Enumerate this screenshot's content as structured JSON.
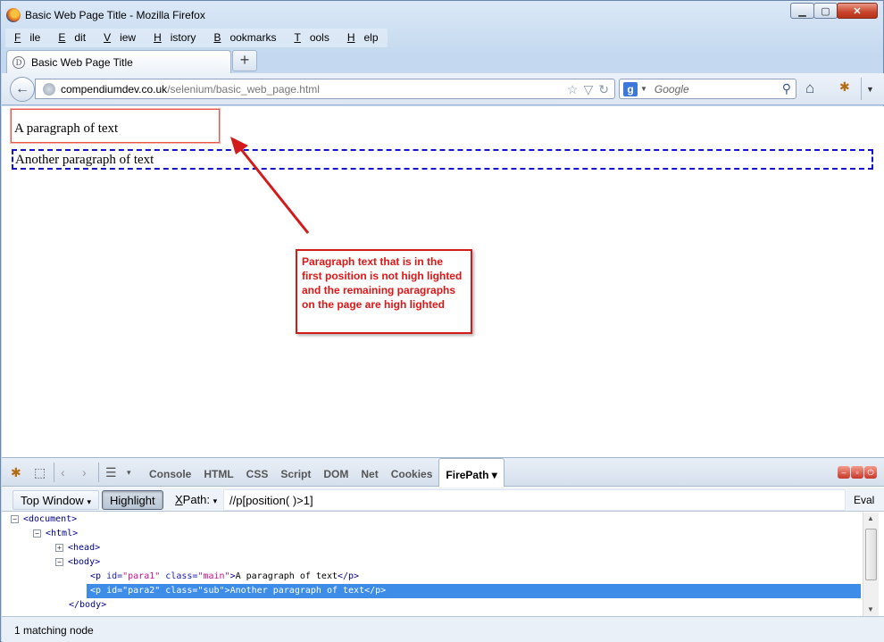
{
  "window": {
    "title": "Basic Web Page Title - Mozilla Firefox",
    "minimize_glyph": "▁",
    "maximize_glyph": "▢",
    "close_glyph": "✕"
  },
  "menubar": {
    "items": [
      {
        "key": "F",
        "rest": "ile"
      },
      {
        "key": "E",
        "rest": "dit"
      },
      {
        "key": "V",
        "rest": "iew"
      },
      {
        "key": "H",
        "rest": "istory"
      },
      {
        "key": "B",
        "rest": "ookmarks"
      },
      {
        "key": "T",
        "rest": "ools"
      },
      {
        "key": "H",
        "rest": "elp"
      }
    ]
  },
  "tabs": {
    "active_label": "Basic Web Page Title",
    "favicon_glyph": "D",
    "new_tab_glyph": "+"
  },
  "navbar": {
    "back_glyph": "←",
    "url_domain": "compendiumdev.co.uk",
    "url_path": "/selenium/basic_web_page.html",
    "search_engine_glyph": "g",
    "search_placeholder": "Google",
    "search_icon": "magnifier-icon",
    "home_icon": "home-icon",
    "firebug_icon": "firebug-icon"
  },
  "page": {
    "para1": "A paragraph of text",
    "para2": "Another paragraph of text",
    "annotation": "Paragraph text that is in the first position is not high lighted and the remaining paragraphs on the page are high lighted",
    "annotation_color": "#e01515"
  },
  "firebug": {
    "tabs": [
      "Console",
      "HTML",
      "CSS",
      "Script",
      "DOM",
      "Net",
      "Cookies"
    ],
    "active_tab": "FirePath",
    "active_tab_caret": "▾",
    "menu_glyph": "☰",
    "win_glyphs": [
      "–",
      "▫",
      "⏻"
    ]
  },
  "firepath": {
    "top_window": "Top Window",
    "highlight": "Highlight",
    "xpath_key": "X",
    "xpath_rest": "Path:",
    "caret": "▾",
    "expression": "//p[position( )>1]",
    "eval": "Eval"
  },
  "tree": {
    "document": "<document>",
    "html": "<html>",
    "head": "<head>",
    "body": "<body>",
    "body_close": "</body>",
    "minus": "−",
    "plus": "+",
    "p1": {
      "open": "<p ",
      "id_attr": "id=",
      "id_val": "\"para1\"",
      "class_attr": " class=",
      "class_val": "\"main\"",
      "gt": ">",
      "text": "A paragraph of text",
      "close": "</p>"
    },
    "p2": {
      "open": "<p ",
      "id_attr": "id=",
      "id_val": "\"para2\"",
      "class_attr": " class=",
      "class_val": "\"sub\"",
      "gt": ">",
      "text": "Another paragraph of text",
      "close": "</p>"
    }
  },
  "status": {
    "text": "1 matching node"
  }
}
